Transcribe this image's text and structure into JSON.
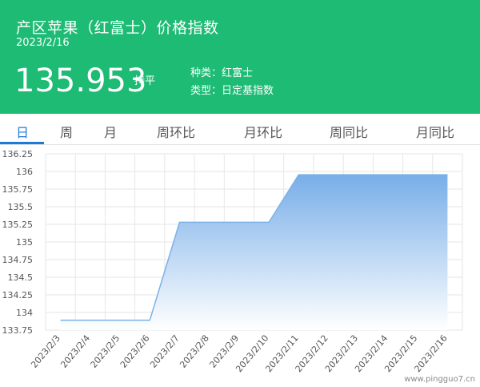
{
  "header": {
    "title": "产区苹果（红富士）价格指数",
    "date": "2023/2/16",
    "value": "135.953",
    "trend": "持平",
    "variety": "种类：红富士",
    "type": "类型：日定基指数",
    "background_color": "#1dbb74"
  },
  "tabs": [
    {
      "label": "日",
      "active": true
    },
    {
      "label": "周",
      "active": false
    },
    {
      "label": "月",
      "active": false
    },
    {
      "label": "周环比",
      "active": false
    },
    {
      "label": "月环比",
      "active": false
    },
    {
      "label": "周同比",
      "active": false
    },
    {
      "label": "月同比",
      "active": false
    }
  ],
  "accent_color": "#1e7ad9",
  "watermark": "www.pingguo7.cn",
  "chart_data": {
    "type": "area",
    "categories": [
      "2023/2/3",
      "2023/2/4",
      "2023/2/5",
      "2023/2/6",
      "2023/2/7",
      "2023/2/8",
      "2023/2/9",
      "2023/2/10",
      "2023/2/11",
      "2023/2/12",
      "2023/2/13",
      "2023/2/14",
      "2023/2/15",
      "2023/2/16"
    ],
    "values": [
      133.89,
      133.89,
      133.89,
      133.89,
      135.28,
      135.28,
      135.28,
      135.28,
      135.953,
      135.953,
      135.953,
      135.953,
      135.953,
      135.953
    ],
    "yticks": [
      "136.25",
      "136",
      "135.75",
      "135.5",
      "135.25",
      "135",
      "134.75",
      "134.5",
      "134.25",
      "134",
      "133.75"
    ],
    "ylim": [
      133.75,
      136.25
    ],
    "grid": true,
    "line_color": "#7ab2e8",
    "fill_top_color": "#78aee8",
    "fill_bottom_color": "#ffffff"
  }
}
